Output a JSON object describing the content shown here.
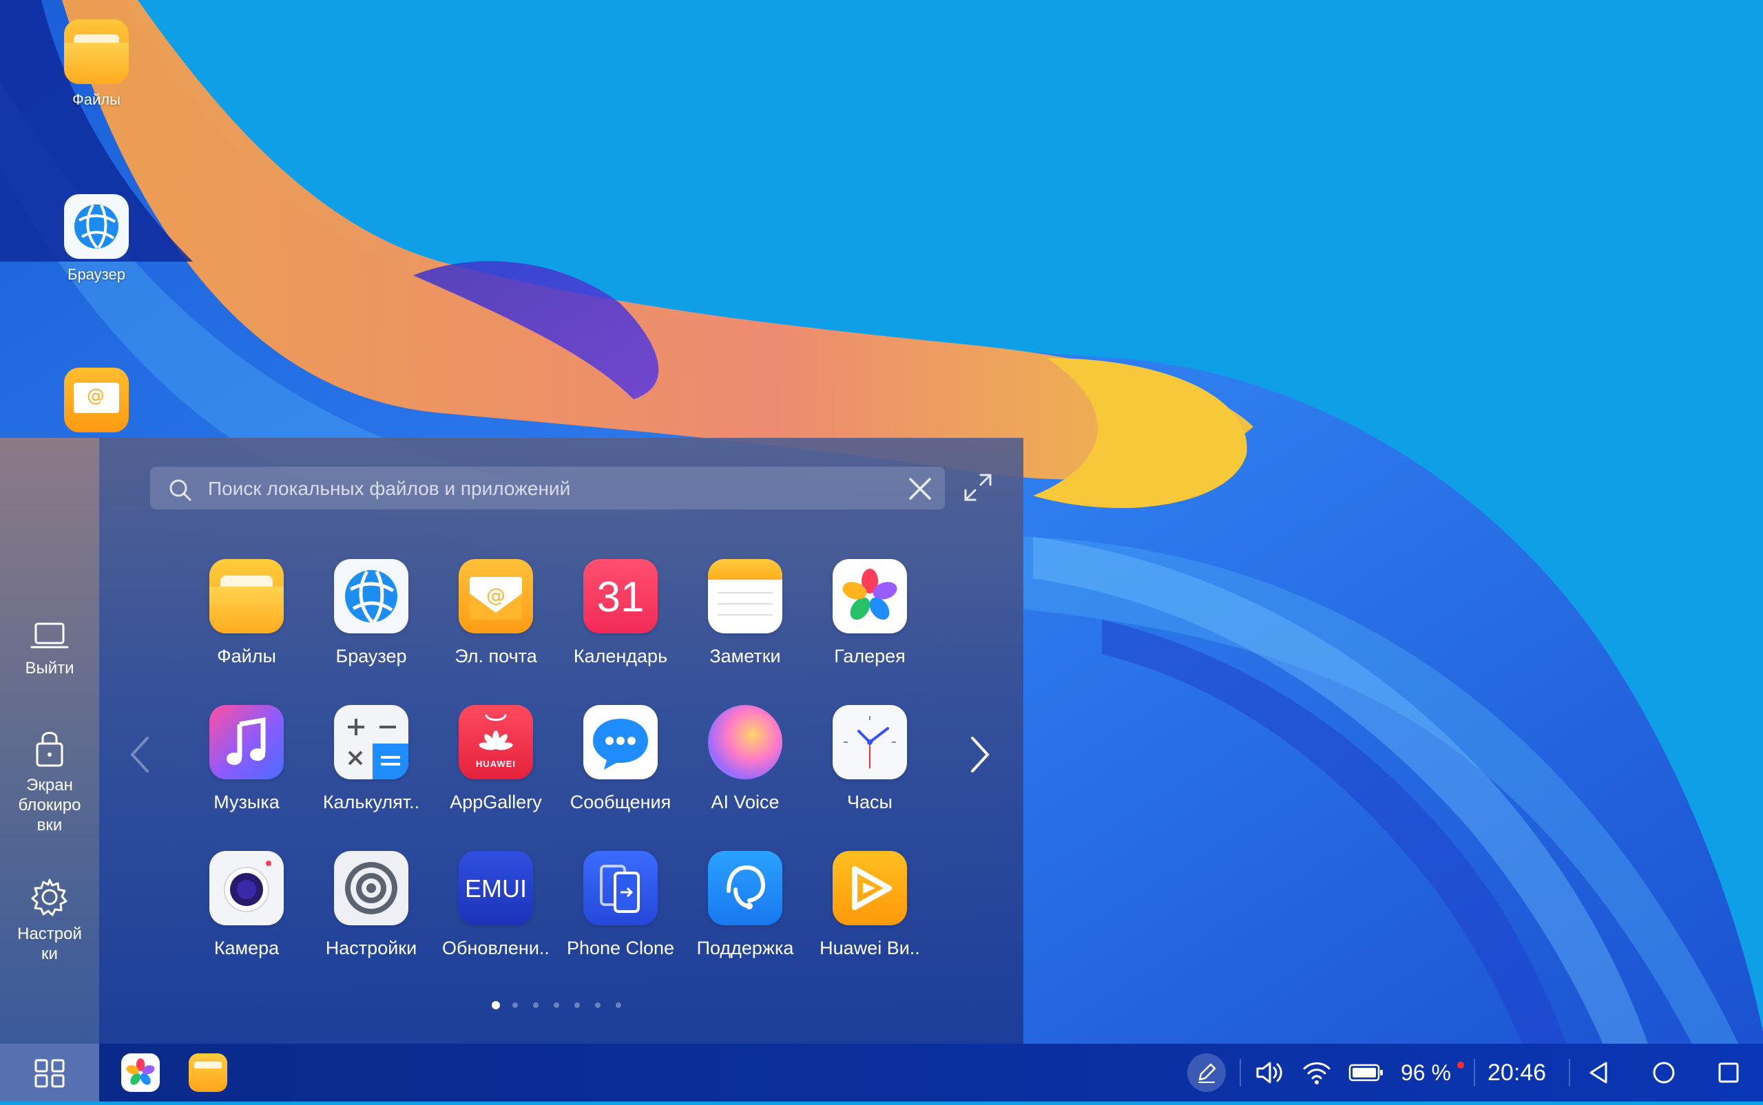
{
  "desktop": {
    "icons": [
      {
        "label": "Файлы",
        "icon": "folder-icon"
      },
      {
        "label": "Браузер",
        "icon": "globe-icon"
      },
      {
        "label": "",
        "icon": "mail-icon"
      }
    ]
  },
  "side_rail": {
    "exit": "Выйти",
    "lock": "Экран\nблокиро\nвки",
    "settings": "Настрой\nки"
  },
  "search": {
    "placeholder": "Поиск локальных файлов и приложений"
  },
  "apps": [
    {
      "label": "Файлы",
      "icon": "folder-icon"
    },
    {
      "label": "Браузер",
      "icon": "globe-icon"
    },
    {
      "label": "Эл. почта",
      "icon": "mail-icon"
    },
    {
      "label": "Календарь",
      "icon": "calendar-icon",
      "text": "31"
    },
    {
      "label": "Заметки",
      "icon": "notes-icon"
    },
    {
      "label": "Галерея",
      "icon": "gallery-icon"
    },
    {
      "label": "Музыка",
      "icon": "music-icon"
    },
    {
      "label": "Калькулят..",
      "icon": "calculator-icon"
    },
    {
      "label": "AppGallery",
      "icon": "appgallery-icon",
      "text": "HUAWEI"
    },
    {
      "label": "Сообщения",
      "icon": "messages-icon"
    },
    {
      "label": "AI Voice",
      "icon": "ai-voice-icon"
    },
    {
      "label": "Часы",
      "icon": "clock-icon"
    },
    {
      "label": "Камера",
      "icon": "camera-icon"
    },
    {
      "label": "Настройки",
      "icon": "settings-icon"
    },
    {
      "label": "Обновлени..",
      "icon": "emui-update-icon",
      "text": "EMUI"
    },
    {
      "label": "Phone Clone",
      "icon": "phone-clone-icon"
    },
    {
      "label": "Поддержка",
      "icon": "support-icon"
    },
    {
      "label": "Huawei Ви..",
      "icon": "huawei-video-icon"
    }
  ],
  "pager": {
    "pages": 7,
    "current": 1
  },
  "taskbar": {
    "pinned": [
      {
        "icon": "gallery-icon"
      },
      {
        "icon": "folder-icon"
      }
    ],
    "battery": "96 %",
    "time": "20:46"
  },
  "colors": {
    "wallpaper_sky": "#0f9fe6",
    "taskbar": "#0b2fa0",
    "accent_red": "#ff2d2d"
  }
}
